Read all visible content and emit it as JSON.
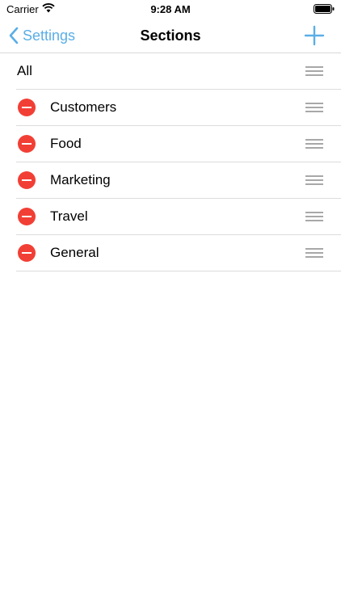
{
  "status_bar": {
    "carrier": "Carrier",
    "time": "9:28 AM",
    "icons": [
      "wifi-icon",
      "battery-icon"
    ]
  },
  "nav": {
    "back_label": "Settings",
    "title": "Sections",
    "back_icon": "chevron-left-icon",
    "add_icon": "plus-icon"
  },
  "list": {
    "all_label": "All",
    "sections": [
      {
        "label": "Customers"
      },
      {
        "label": "Food"
      },
      {
        "label": "Marketing"
      },
      {
        "label": "Travel"
      },
      {
        "label": "General"
      }
    ]
  },
  "colors": {
    "accent": "#5aaee6",
    "delete": "#f23f35",
    "separator": "#dcdcdc",
    "handle": "#a8a8a8"
  }
}
